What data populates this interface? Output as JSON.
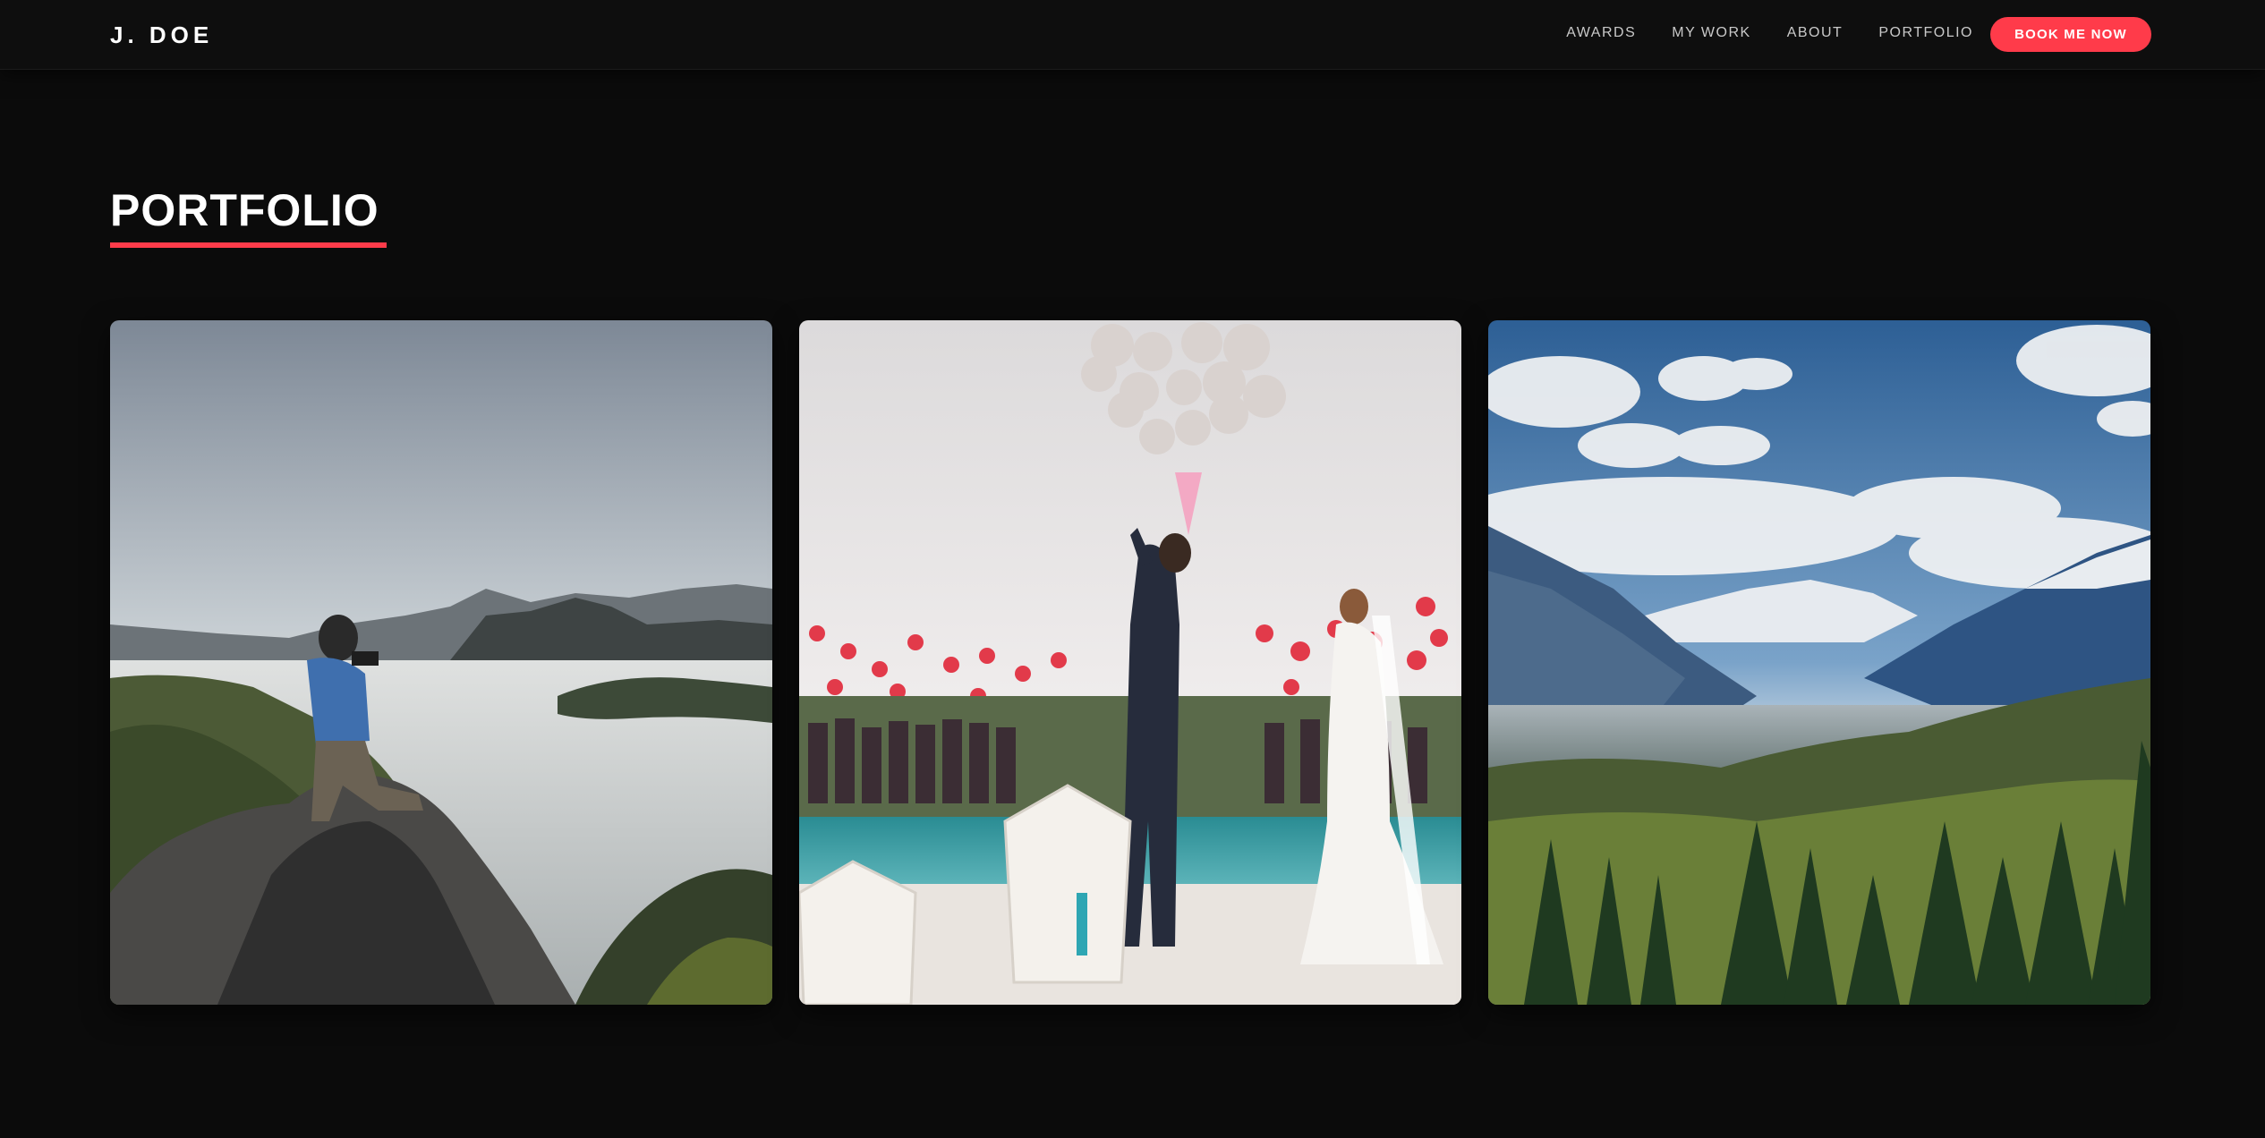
{
  "header": {
    "brand": "J. DOE",
    "nav": [
      "AWARDS",
      "MY WORK",
      "ABOUT",
      "PORTFOLIO"
    ],
    "cta_label": "BOOK ME NOW",
    "accent_color": "#ff3b4a"
  },
  "portfolio": {
    "title": "PORTFOLIO",
    "items": [
      {
        "icon": "photo-hiker-photographer-mountain"
      },
      {
        "icon": "photo-wedding-balloons-couple"
      },
      {
        "icon": "photo-mountain-valley-landscape"
      }
    ]
  }
}
